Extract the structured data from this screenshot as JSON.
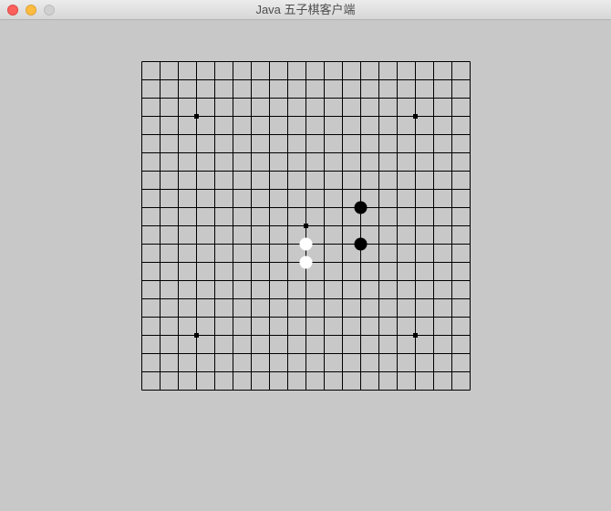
{
  "window": {
    "title": "Java 五子棋客户端"
  },
  "colors": {
    "background": "#c8c8c8",
    "grid": "#000000",
    "black_stone": "#000000",
    "white_stone": "#ffffff"
  },
  "board": {
    "lines": 19,
    "star_points": [
      [
        3,
        3
      ],
      [
        15,
        3
      ],
      [
        9,
        9
      ],
      [
        3,
        15
      ],
      [
        15,
        15
      ]
    ],
    "stones": [
      {
        "color": "black",
        "col": 12,
        "row": 8
      },
      {
        "color": "black",
        "col": 12,
        "row": 10
      },
      {
        "color": "white",
        "col": 9,
        "row": 10
      },
      {
        "color": "white",
        "col": 9,
        "row": 11
      }
    ]
  }
}
